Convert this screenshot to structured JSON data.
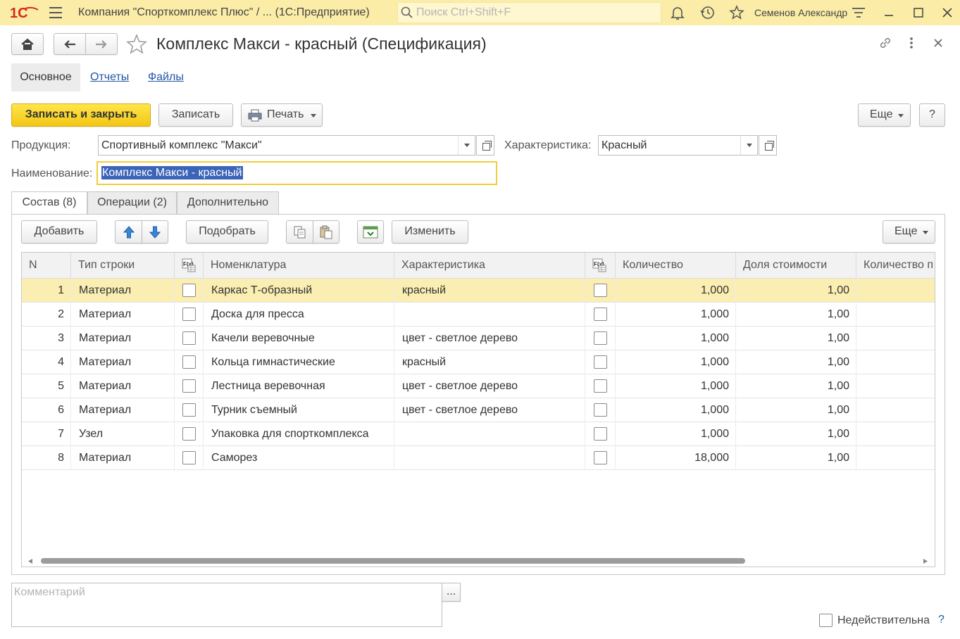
{
  "app": {
    "title": "Компания \"Спорткомплекс Плюс\" / ...  (1С:Предприятие)",
    "search_placeholder": "Поиск Ctrl+Shift+F",
    "user": "Семенов Александр",
    "logo": "1С"
  },
  "window": {
    "title": "Комплекс Макси - красный (Спецификация)"
  },
  "nav": {
    "tabs": [
      "Основное",
      "Отчеты",
      "Файлы"
    ]
  },
  "toolbar": {
    "save_close": "Записать и закрыть",
    "save": "Записать",
    "print": "Печать",
    "more": "Еще",
    "help": "?"
  },
  "form": {
    "product_label": "Продукция:",
    "product_value": "Спортивный комплекс \"Макси\"",
    "characteristic_label": "Характеристика:",
    "characteristic_value": "Красный",
    "name_label": "Наименование:",
    "name_value": "Комплекс Макси - красный"
  },
  "tabs": [
    "Состав (8)",
    "Операции (2)",
    "Дополнительно"
  ],
  "table_toolbar": {
    "add": "Добавить",
    "pick": "Подобрать",
    "change": "Изменить",
    "more": "Еще"
  },
  "table": {
    "columns": [
      "N",
      "Тип строки",
      "Номенклатура",
      "Характеристика",
      "Количество",
      "Доля стоимости",
      "Количество п"
    ],
    "rows": [
      {
        "n": "1",
        "type": "Материал",
        "item": "Каркас Т-образный",
        "char": "красный",
        "qty": "1,000",
        "share": "1,00"
      },
      {
        "n": "2",
        "type": "Материал",
        "item": "Доска для пресса",
        "char": "",
        "qty": "1,000",
        "share": "1,00"
      },
      {
        "n": "3",
        "type": "Материал",
        "item": "Качели веревочные",
        "char": "цвет - светлое дерево",
        "qty": "1,000",
        "share": "1,00"
      },
      {
        "n": "4",
        "type": "Материал",
        "item": "Кольца гимнастические",
        "char": "красный",
        "qty": "1,000",
        "share": "1,00"
      },
      {
        "n": "5",
        "type": "Материал",
        "item": "Лестница веревочная",
        "char": "цвет - светлое дерево",
        "qty": "1,000",
        "share": "1,00"
      },
      {
        "n": "6",
        "type": "Материал",
        "item": "Турник съемный",
        "char": "цвет - светлое дерево",
        "qty": "1,000",
        "share": "1,00"
      },
      {
        "n": "7",
        "type": "Узел",
        "item": "Упаковка для спорткомплекса",
        "char": "",
        "qty": "1,000",
        "share": "1,00"
      },
      {
        "n": "8",
        "type": "Материал",
        "item": "Саморез",
        "char": "",
        "qty": "18,000",
        "share": "1,00"
      }
    ]
  },
  "footer": {
    "comment_placeholder": "Комментарий",
    "comment_button": "...",
    "invalid_label": "Недействительна",
    "help": "?"
  }
}
